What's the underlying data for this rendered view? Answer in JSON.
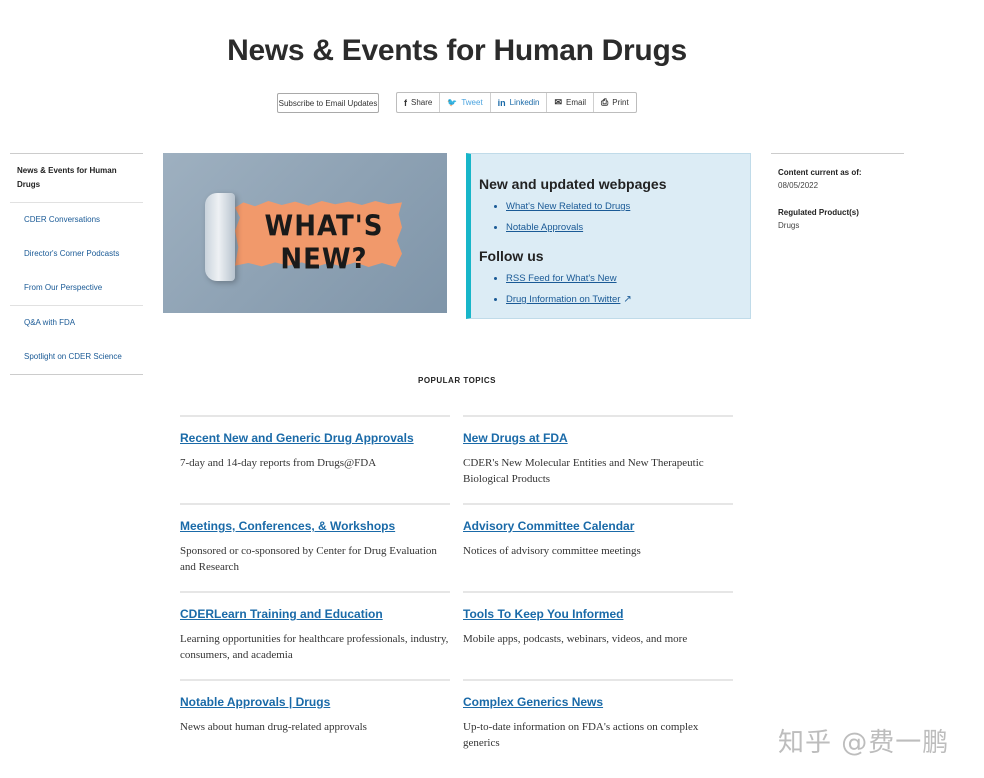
{
  "page": {
    "title": "News & Events for Human Drugs"
  },
  "actions": {
    "subscribe_label": "Subscribe to Email Updates",
    "share": [
      {
        "icon": "f",
        "label": "Share",
        "color": "#333333"
      },
      {
        "icon": "🐦",
        "label": "Tweet",
        "color": "#4aa3df"
      },
      {
        "icon": "in",
        "label": "Linkedin",
        "color": "#1a6aa8"
      },
      {
        "icon": "✉",
        "label": "Email",
        "color": "#333333"
      },
      {
        "icon": "⎙",
        "label": "Print",
        "color": "#333333"
      }
    ]
  },
  "sidebar": {
    "header": "News & Events for Human Drugs",
    "items": [
      {
        "label": "CDER Conversations"
      },
      {
        "label": "Director's Corner Podcasts"
      },
      {
        "label": "From Our Perspective"
      },
      {
        "label": "Q&A with FDA"
      },
      {
        "label": "Spotlight on CDER Science"
      }
    ]
  },
  "hero": {
    "text": "WHAT'S NEW?"
  },
  "infobox": {
    "heading1": "New and updated webpages",
    "links1": [
      {
        "label": "What's New Related to Drugs"
      },
      {
        "label": "Notable Approvals"
      }
    ],
    "heading2": "Follow us",
    "links2": [
      {
        "label": "RSS Feed for What's New"
      },
      {
        "label": "Drug Information on Twitter"
      }
    ]
  },
  "meta": {
    "content_label": "Content current as of:",
    "content_value": "08/05/2022",
    "product_label": "Regulated Product(s)",
    "product_value": "Drugs"
  },
  "popular": {
    "heading": "POPULAR TOPICS",
    "topics": [
      {
        "title": "Recent New and Generic Drug Approvals",
        "desc": "7-day and 14-day reports from Drugs@FDA"
      },
      {
        "title": "New Drugs at FDA",
        "desc": "CDER's New Molecular Entities and New Therapeutic Biological Products"
      },
      {
        "title": "Meetings, Conferences, & Workshops",
        "desc": "Sponsored or co-sponsored by Center for Drug Evaluation and Research"
      },
      {
        "title": "Advisory Committee Calendar",
        "desc": "Notices of advisory committee meetings"
      },
      {
        "title": "CDERLearn Training and Education",
        "desc": "Learning opportunities for healthcare professionals, industry, consumers, and academia"
      },
      {
        "title": "Tools To Keep You Informed",
        "desc": "Mobile apps, podcasts, webinars, videos, and more"
      },
      {
        "title": "Notable Approvals | Drugs",
        "desc": "News about human drug-related approvals"
      },
      {
        "title": "Complex Generics News",
        "desc": "Up-to-date information on FDA's actions on complex generics"
      }
    ]
  },
  "watermark": "知乎 @费一鹏",
  "colors": {
    "link": "#1a6aa8",
    "accent_bar": "#18b6c9",
    "infobox_bg": "#dcecf5"
  }
}
